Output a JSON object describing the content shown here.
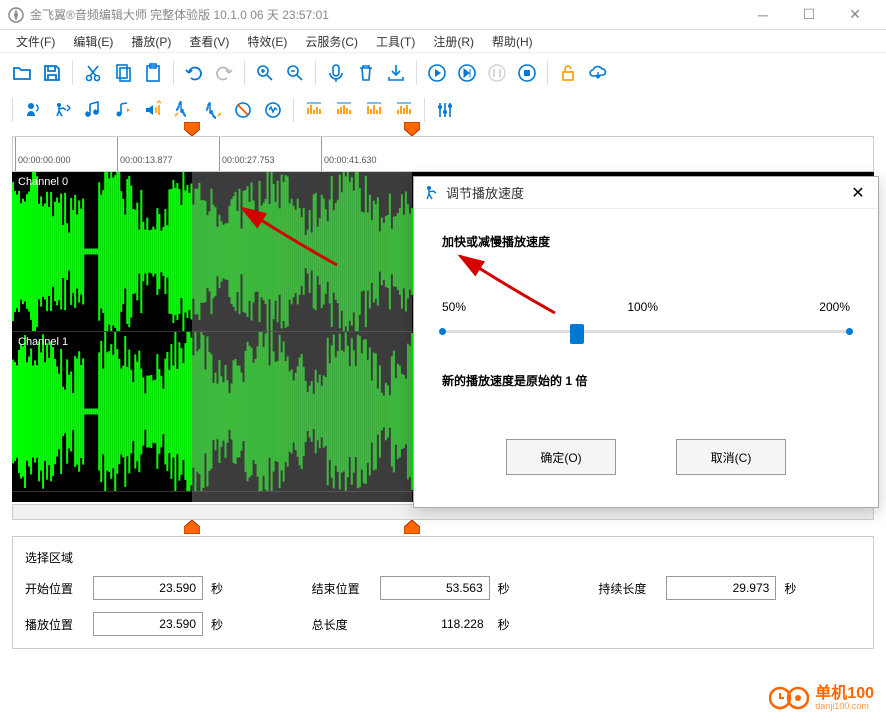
{
  "titlebar": {
    "text": "金飞翼®音频编辑大师 完整体验版 10.1.0 06 天 23:57:01"
  },
  "menu": {
    "items": [
      "文件(F)",
      "编辑(E)",
      "播放(P)",
      "查看(V)",
      "特效(E)",
      "云服务(C)",
      "工具(T)",
      "注册(R)",
      "帮助(H)"
    ]
  },
  "ruler": {
    "ticks": [
      "00:00:00.000",
      "00:00:13.877",
      "00:00:27.753",
      "00:00:41.630"
    ]
  },
  "channels": {
    "ch0": "Channel 0",
    "ch1": "Channel 1"
  },
  "info": {
    "section_title": "选择区域",
    "start_label": "开始位置",
    "start_value": "23.590",
    "end_label": "结束位置",
    "end_value": "53.563",
    "duration_label": "持续长度",
    "duration_value": "29.973",
    "play_label": "播放位置",
    "play_value": "23.590",
    "total_label": "总长度",
    "total_value": "118.228",
    "unit": "秒"
  },
  "dialog": {
    "title": "调节播放速度",
    "description": "加快或减慢播放速度",
    "slider": {
      "min_label": "50%",
      "mid_label": "100%",
      "max_label": "200%",
      "value_pct": 33
    },
    "result": "新的播放速度是原始的 1 倍",
    "ok": "确定(O)",
    "cancel": "取消(C)"
  },
  "watermark": {
    "text": "单机100",
    "suffix": "danji100.com"
  },
  "colors": {
    "accent": "#0078d4",
    "waveform": "#00ff00",
    "marker": "#ff6600",
    "arrow": "#d40000"
  }
}
